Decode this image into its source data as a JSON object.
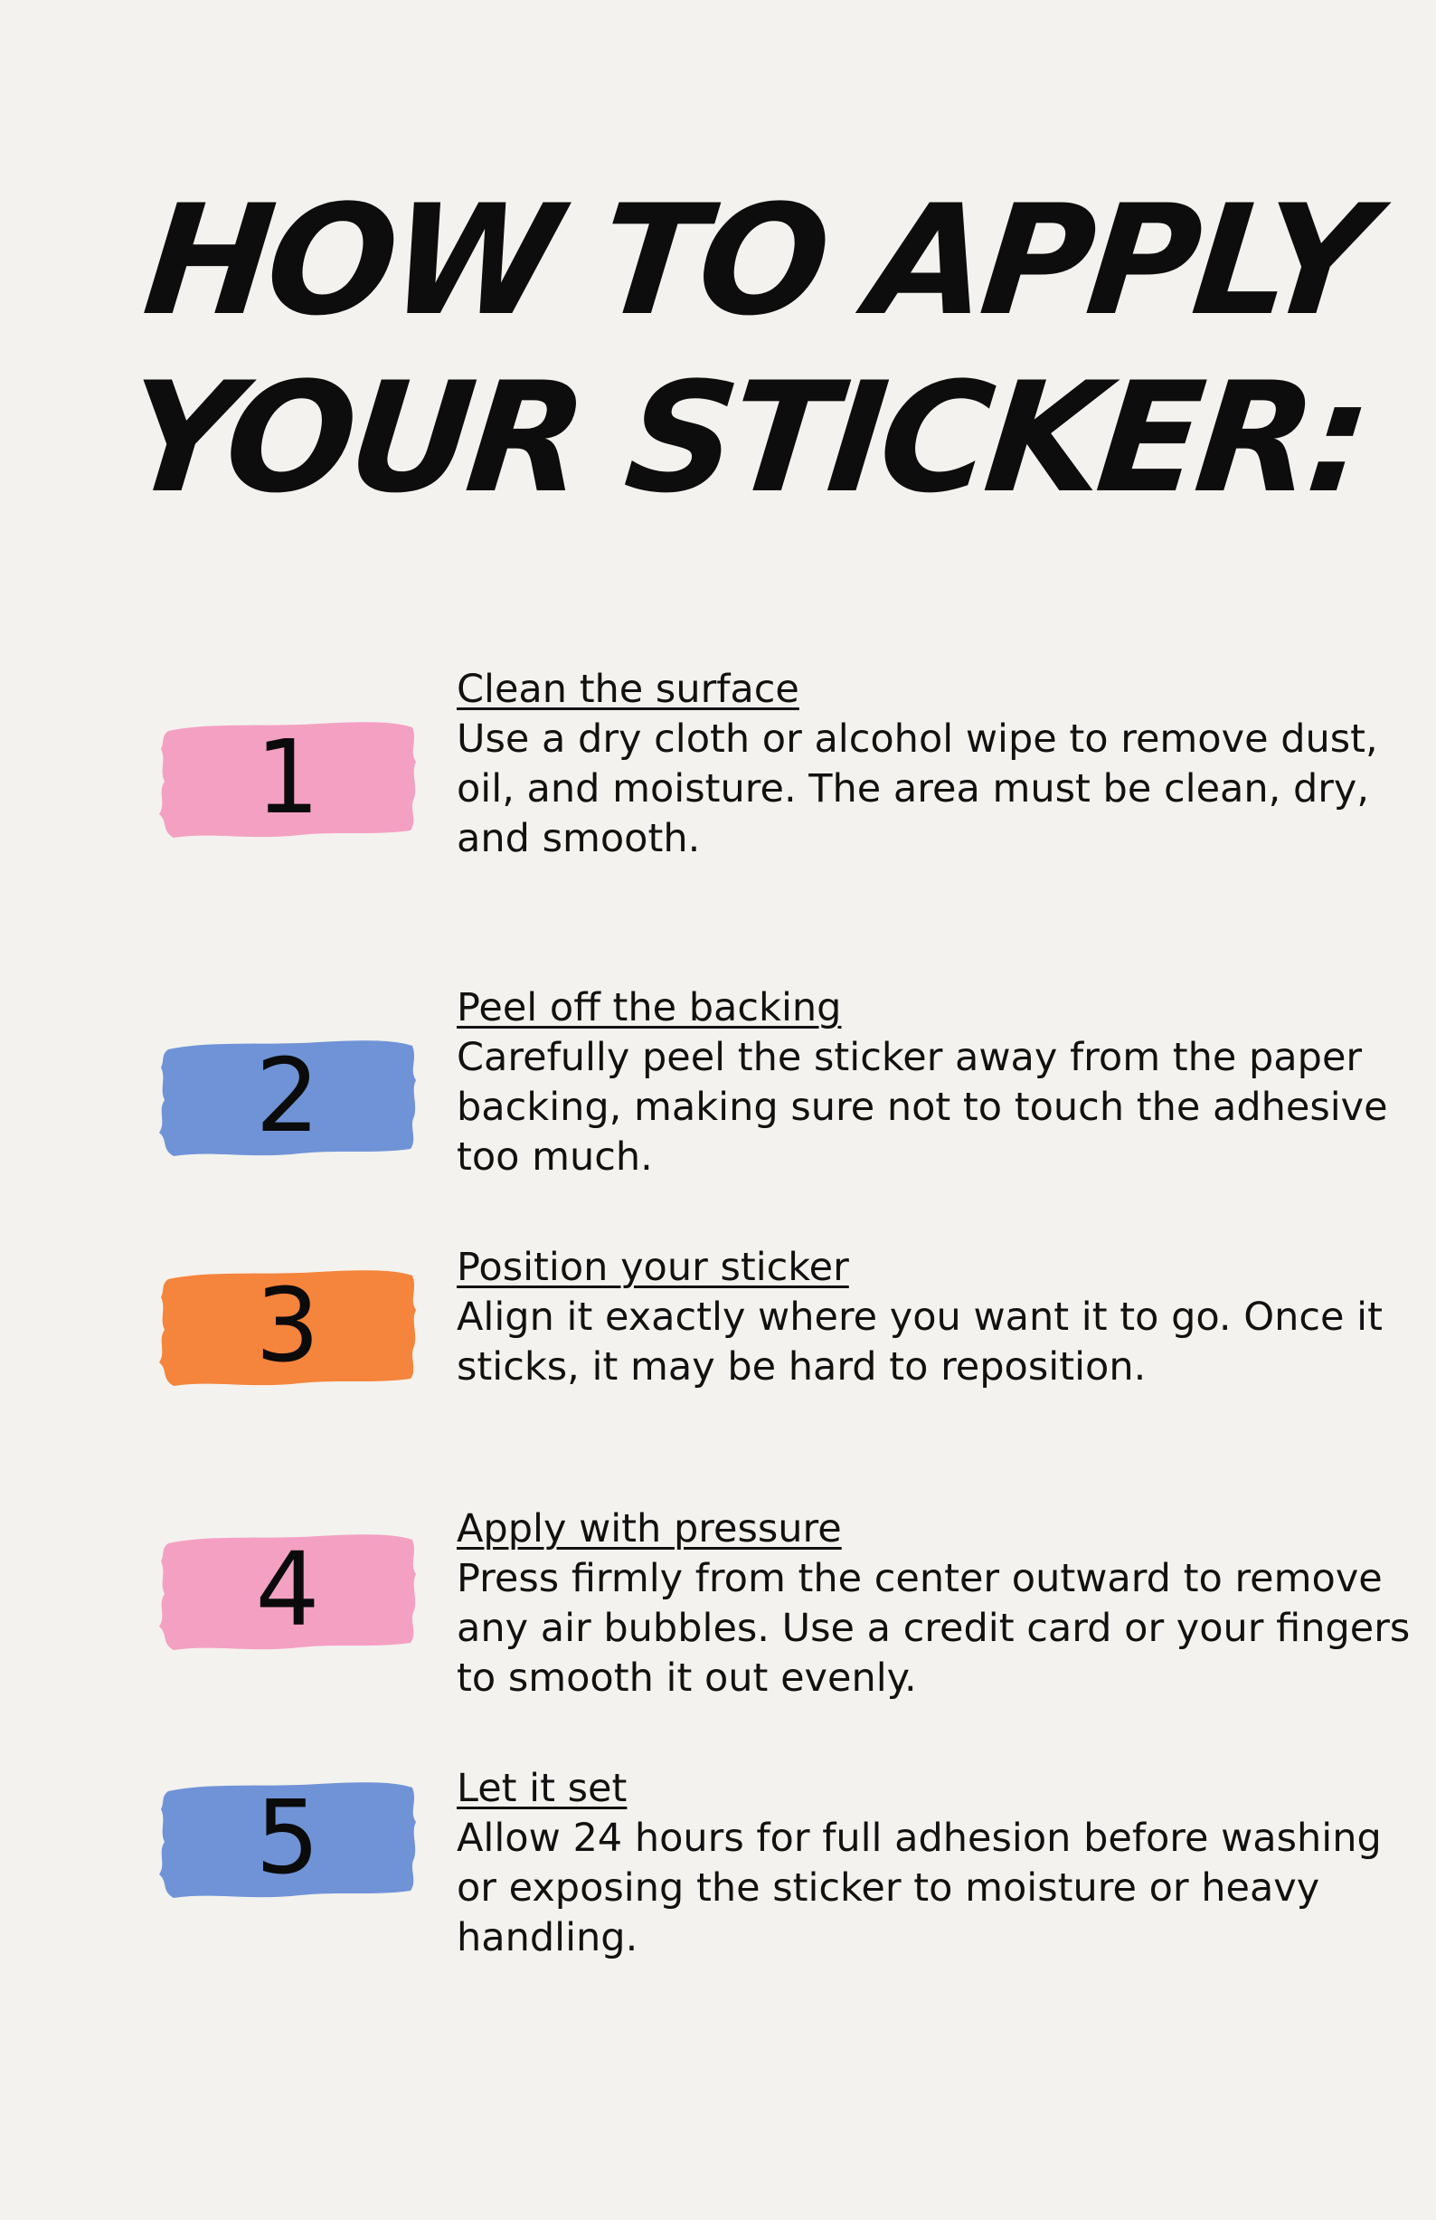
{
  "title": {
    "line1": "HOW TO APPLY",
    "line2": "YOUR STICKER:"
  },
  "colors": {
    "background": "#f4f2ee",
    "pink": "#f4a0c3",
    "blue": "#6f93d6",
    "orange": "#f5843c",
    "text": "#111111"
  },
  "steps": [
    {
      "number": "1",
      "color": "pink",
      "heading": "Clean the surface",
      "body": "Use a dry cloth or alcohol wipe to remove dust, oil, and moisture. The area must be clean, dry, and smooth."
    },
    {
      "number": "2",
      "color": "blue",
      "heading": "Peel off the backing",
      "body": "Carefully peel the sticker away from the paper backing, making sure not to touch the adhesive too much."
    },
    {
      "number": "3",
      "color": "orange",
      "heading": "Position your sticker",
      "body": "Align it exactly where you want it to go. Once it sticks, it may be hard to reposition."
    },
    {
      "number": "4",
      "color": "pink",
      "heading": "Apply with pressure",
      "body": "Press firmly from the center outward to remove any air bubbles. Use a credit card or your fingers to smooth it out evenly."
    },
    {
      "number": "5",
      "color": "blue",
      "heading": "Let it set",
      "body": "Allow 24 hours for full adhesion before washing or exposing the sticker to moisture or heavy handling."
    }
  ]
}
